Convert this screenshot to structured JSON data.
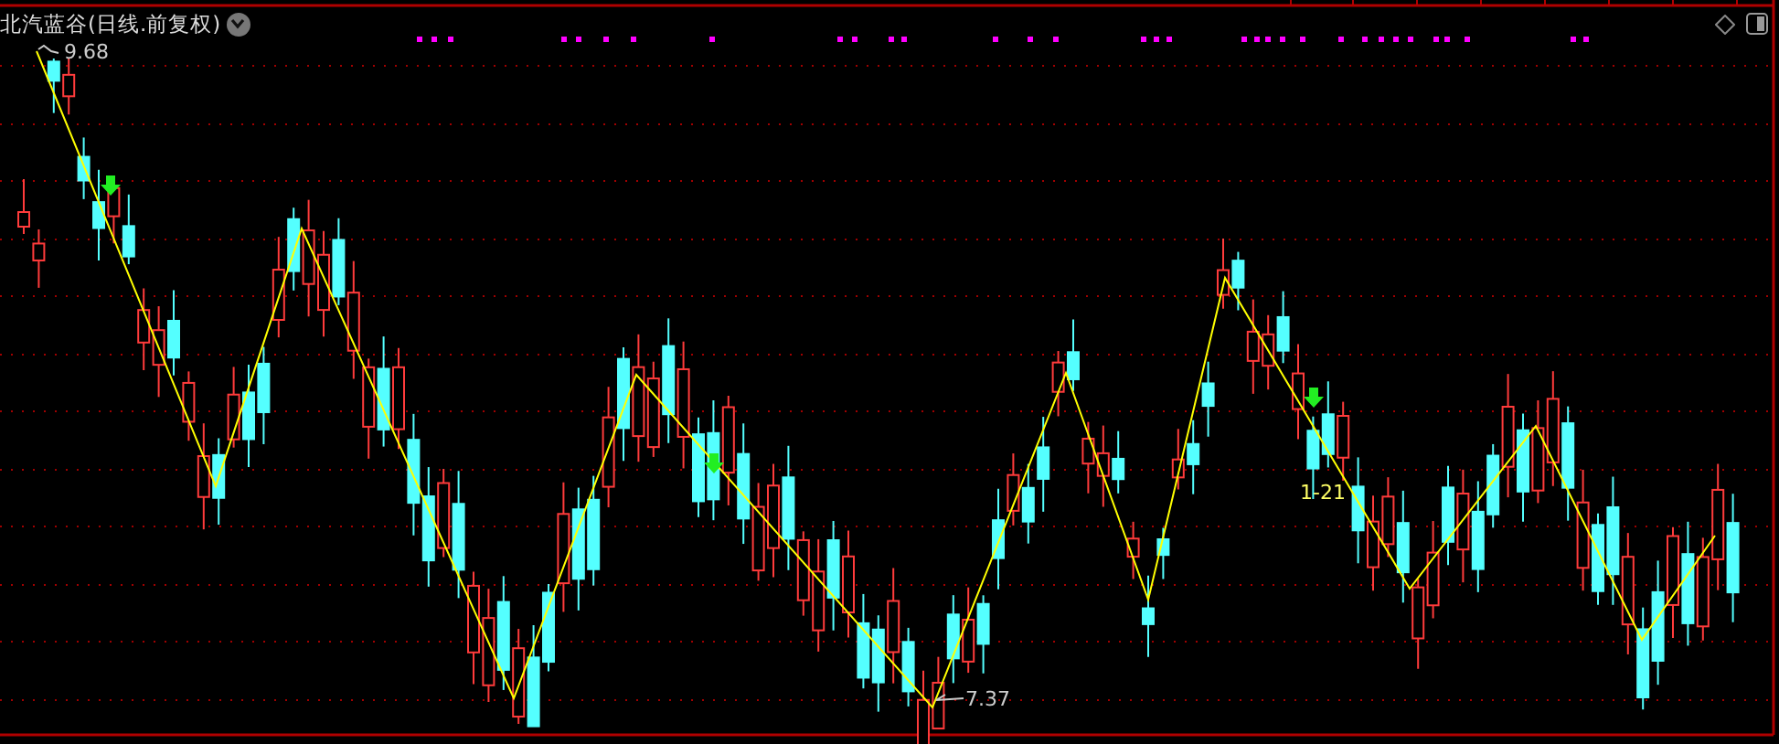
{
  "chart": {
    "title": "北汽蓝谷(日线.前复权)",
    "high_label": "9.68",
    "low_label": "7.37",
    "marker_label": "1-21"
  }
}
